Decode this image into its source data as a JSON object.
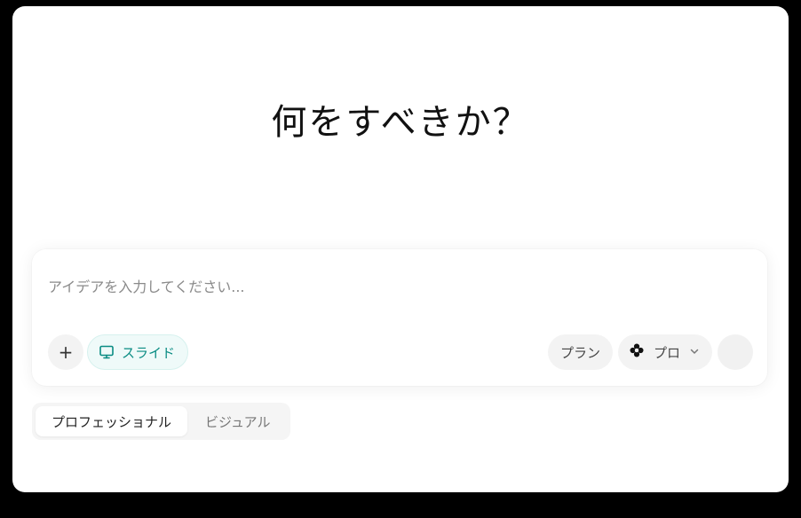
{
  "headline": "何をすべきか？",
  "composer": {
    "placeholder": "アイデアを入力してください...",
    "add_label": "+",
    "slide_chip": {
      "label": "スライド",
      "icon": "presentation-icon"
    },
    "plan_label": "プラン",
    "model": {
      "label": "プロ",
      "icon": "flower-icon",
      "chevron": "chevron-down-icon"
    }
  },
  "modes": {
    "items": [
      {
        "label": "プロフェッショナル",
        "active": true
      },
      {
        "label": "ビジュアル",
        "active": false
      }
    ]
  },
  "colors": {
    "accent": "#0a8c83",
    "chip_bg": "#effaf9",
    "pill_bg": "#f3f3f3"
  }
}
